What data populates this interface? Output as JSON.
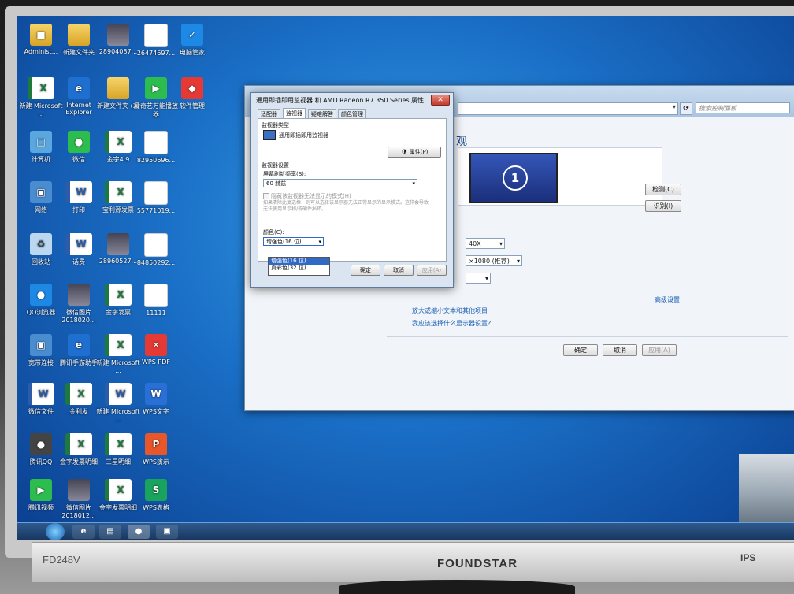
{
  "desktop": {
    "icons": [
      {
        "label": "Administ...",
        "glyph": "■",
        "icon": "user-folder-icon"
      },
      {
        "label": "新建文件夹",
        "glyph": "",
        "icon": "folder-icon"
      },
      {
        "label": "28904087...",
        "glyph": "",
        "icon": "image-file-icon"
      },
      {
        "label": "26474697...",
        "glyph": "",
        "icon": "document-icon"
      },
      {
        "label": "电脑管家",
        "glyph": "✓",
        "icon": "pc-manager-shield-icon"
      },
      {
        "label": "新建 Microsoft ...",
        "glyph": "X",
        "icon": "excel-file-icon"
      },
      {
        "label": "Internet Explorer",
        "glyph": "e",
        "icon": "internet-explorer-icon"
      },
      {
        "label": "新建文件夹 (2)",
        "glyph": "",
        "icon": "folder-icon"
      },
      {
        "label": "爱奇艺万能播放器",
        "glyph": "▶",
        "icon": "video-player-icon"
      },
      {
        "label": "软件管理",
        "glyph": "◆",
        "icon": "software-manager-icon"
      },
      {
        "label": "计算机",
        "glyph": "□",
        "icon": "computer-icon"
      },
      {
        "label": "微信",
        "glyph": "●",
        "icon": "wechat-icon"
      },
      {
        "label": "金字4.9",
        "glyph": "X",
        "icon": "excel-file-icon"
      },
      {
        "label": "82950696...",
        "glyph": "",
        "icon": "document-icon"
      },
      {
        "label": "网络",
        "glyph": "▣",
        "icon": "network-icon"
      },
      {
        "label": "打印",
        "glyph": "W",
        "icon": "word-file-icon"
      },
      {
        "label": "宝利源发票",
        "glyph": "X",
        "icon": "excel-file-icon"
      },
      {
        "label": "55771019...",
        "glyph": "",
        "icon": "document-icon"
      },
      {
        "label": "回收站",
        "glyph": "♻",
        "icon": "recycle-bin-icon"
      },
      {
        "label": "话费",
        "glyph": "W",
        "icon": "word-file-icon"
      },
      {
        "label": "28960527...",
        "glyph": "",
        "icon": "image-file-icon"
      },
      {
        "label": "84850292...",
        "glyph": "",
        "icon": "document-icon"
      },
      {
        "label": "QQ浏览器",
        "glyph": "●",
        "icon": "qq-browser-icon"
      },
      {
        "label": "微信图片 2018020...",
        "glyph": "",
        "icon": "image-file-icon"
      },
      {
        "label": "金字发票",
        "glyph": "X",
        "icon": "excel-file-icon"
      },
      {
        "label": "11111",
        "glyph": "",
        "icon": "document-icon"
      },
      {
        "label": "宽带连接",
        "glyph": "▣",
        "icon": "broadband-connection-icon"
      },
      {
        "label": "腾讯手游助手",
        "glyph": "e",
        "icon": "game-assistant-icon"
      },
      {
        "label": "新建 Microsoft ...",
        "glyph": "X",
        "icon": "excel-file-icon"
      },
      {
        "label": "WPS PDF",
        "glyph": "✕",
        "icon": "wps-pdf-icon"
      },
      {
        "label": "微信文件",
        "glyph": "W",
        "icon": "word-file-icon"
      },
      {
        "label": "金利发",
        "glyph": "X",
        "icon": "excel-file-icon"
      },
      {
        "label": "新建 Microsoft ...",
        "glyph": "W",
        "icon": "word-file-icon"
      },
      {
        "label": "WPS文字",
        "glyph": "W",
        "icon": "wps-writer-icon"
      },
      {
        "label": "腾讯QQ",
        "glyph": "●",
        "icon": "qq-icon"
      },
      {
        "label": "金字发票明细",
        "glyph": "X",
        "icon": "excel-file-icon"
      },
      {
        "label": "三星明细",
        "glyph": "X",
        "icon": "excel-file-icon"
      },
      {
        "label": "WPS演示",
        "glyph": "P",
        "icon": "wps-presentation-icon"
      },
      {
        "label": "腾讯视频",
        "glyph": "▶",
        "icon": "tencent-video-icon"
      },
      {
        "label": "微信图片 2018012...",
        "glyph": "",
        "icon": "image-file-icon"
      },
      {
        "label": "金字发票明细",
        "glyph": "X",
        "icon": "excel-file-icon"
      },
      {
        "label": "WPS表格",
        "glyph": "S",
        "icon": "wps-spreadsheet-icon"
      }
    ]
  },
  "control_panel": {
    "address": "",
    "search_placeholder": "搜索控制面板",
    "title_fragment": "观",
    "monitor_number": "1",
    "detect_button": "检测(C)",
    "identify_button": "识别(I)",
    "resolution_partial": "×1080 (推荐)",
    "orientation_partial": "40X",
    "advanced_link": "高级设置",
    "text_size_link": "放大或缩小文本和其他项目",
    "which_settings_link": "我应该选择什么显示器设置?",
    "ok_button": "确定",
    "cancel_button": "取消",
    "apply_button": "应用(A)"
  },
  "dialog": {
    "title": "通用即插即用监视器 和 AMD Radeon R7 350 Series 属性",
    "close_label": "✕",
    "tabs": [
      "适配器",
      "监视器",
      "疑难解答",
      "颜色管理"
    ],
    "monitor_type_heading": "监视器类型",
    "monitor_name": "通用即插即用监视器",
    "properties_button": "属性(P)",
    "monitor_settings_heading": "监视器设置",
    "refresh_rate_label": "屏幕刷新频率(S):",
    "refresh_rate_value": "60 赫兹",
    "hide_modes_label": "隐藏该监视器无法显示的模式(H)",
    "hide_modes_note": "如果清除此复选框，则可以选择该显示器无法正常显示的显示模式。这样会导致无法使用显示和/或硬件损坏。",
    "colors_label": "颜色(C):",
    "colors_value": "增强色(16 位)",
    "colors_options": [
      "增强色(16 位)",
      "真彩色(32 位)"
    ],
    "ok_button": "确定",
    "cancel_button": "取消",
    "apply_button": "应用(A)"
  },
  "monitor": {
    "model": "FD248V",
    "brand": "FOUNDSTAR",
    "badge": "IPS"
  },
  "taskbar": {
    "items": [
      "e",
      "▤",
      "●",
      "▣"
    ]
  }
}
